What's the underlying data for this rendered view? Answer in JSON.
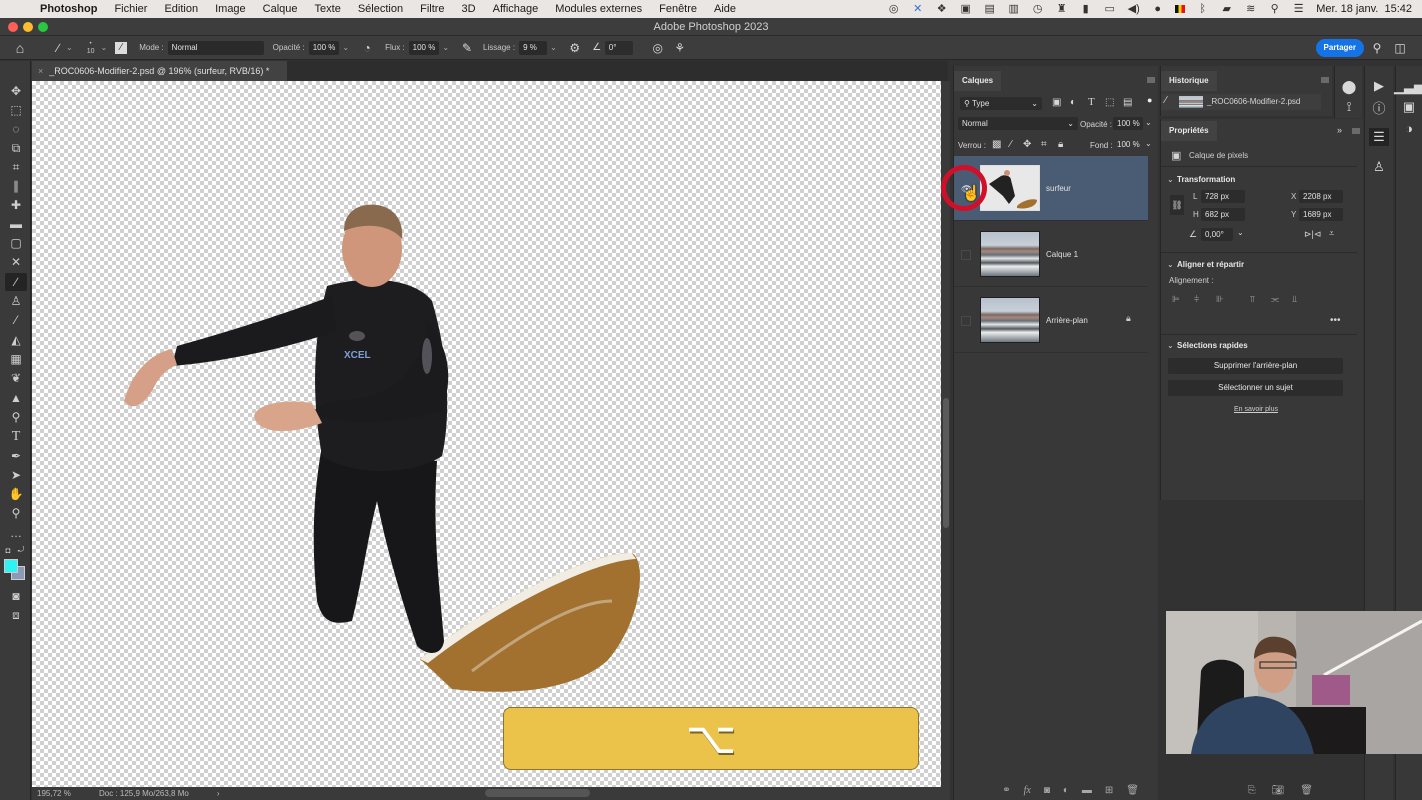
{
  "menubar": {
    "app_name": "Photoshop",
    "items": [
      "Fichier",
      "Edition",
      "Image",
      "Calque",
      "Texte",
      "Sélection",
      "Filtre",
      "3D",
      "Affichage",
      "Modules externes",
      "Fenêtre",
      "Aide"
    ],
    "status_icons": [
      "creative-cloud-icon",
      "bartender-icon",
      "dropbox-icon",
      "camera-icon",
      "screen-record-icon",
      "clipboard-icon",
      "timemachine-icon",
      "binoculars-icon",
      "sidebar-icon",
      "display-icon",
      "volume-icon",
      "cloud-icon",
      "flag-be-icon",
      "bluetooth-icon",
      "battery-icon",
      "wifi-icon",
      "spotlight-icon",
      "control-center-icon"
    ],
    "datetime": "Mer. 18 janv.  15:42"
  },
  "window": {
    "title": "Adobe Photoshop 2023"
  },
  "options_bar": {
    "brush_size": "10",
    "mode_label": "Mode :",
    "mode_value": "Normal",
    "opacity_label": "Opacité :",
    "opacity_value": "100 %",
    "flow_label": "Flux :",
    "flow_value": "100 %",
    "smoothing_label": "Lissage :",
    "smoothing_value": "9 %",
    "angle_value": "0°",
    "share_label": "Partager"
  },
  "document": {
    "tab_title": "_ROC0606-Modifier-2.psd @ 196% (surfeur, RVB/16) *",
    "zoom": "195,72 %",
    "doc_info": "Doc : 125,9 Mo/263,8 Mo"
  },
  "tools": [
    "move",
    "marquee",
    "lasso",
    "object-select",
    "crop",
    "eyedropper",
    "spot-healing",
    "healing",
    "patch",
    "content-aware-move",
    "brush",
    "stamp",
    "history-brush",
    "eraser",
    "gradient",
    "smudge",
    "sharpen",
    "dodge",
    "type",
    "pen",
    "path-select",
    "hand",
    "zoom",
    "more"
  ],
  "colors": {
    "foreground": "#2ff2f2",
    "background": "#8a9ab8",
    "accent": "#1473e6",
    "keycap": "#ecc34a",
    "selected_layer": "#4a5c74",
    "highlight_circle": "#d0102a"
  },
  "layers_panel": {
    "tab": "Calques",
    "filter_label": "Type",
    "blend_mode": "Normal",
    "opacity_label": "Opacité :",
    "opacity_value": "100 %",
    "lock_label": "Verrou :",
    "fill_label": "Fond :",
    "fill_value": "100 %",
    "layers": [
      {
        "name": "surfeur",
        "selected": true,
        "visible": true,
        "locked": false
      },
      {
        "name": "Calque 1",
        "selected": false,
        "visible": false,
        "locked": false
      },
      {
        "name": "Arrière-plan",
        "selected": false,
        "visible": false,
        "locked": true
      }
    ]
  },
  "history_panel": {
    "tab": "Historique",
    "snapshot": "_ROC0606-Modifier-2.psd"
  },
  "properties_panel": {
    "tab": "Propriétés",
    "type": "Calque de pixels",
    "transform_title": "Transformation",
    "w_label": "L",
    "w_value": "728 px",
    "h_label": "H",
    "h_value": "682 px",
    "x_label": "X",
    "x_value": "2208 px",
    "y_label": "Y",
    "y_value": "1689 px",
    "angle_value": "0,00°",
    "align_title": "Aligner et répartir",
    "align_label": "Alignement :",
    "quick_title": "Sélections rapides",
    "remove_bg": "Supprimer l'arrière-plan",
    "select_subject": "Sélectionner un sujet",
    "learn_more": "En savoir plus"
  },
  "keycap": {
    "symbol": "⌥"
  }
}
